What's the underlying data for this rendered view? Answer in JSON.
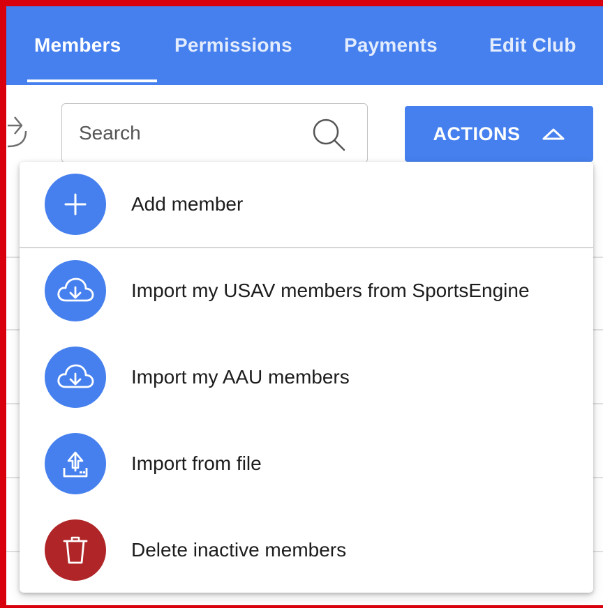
{
  "nav": {
    "tabs": [
      {
        "label": "Members",
        "active": true
      },
      {
        "label": "Permissions",
        "active": false
      },
      {
        "label": "Payments",
        "active": false
      },
      {
        "label": "Edit Club",
        "active": false
      }
    ]
  },
  "search": {
    "placeholder": "Search"
  },
  "actions": {
    "label": "ACTIONS"
  },
  "menu": {
    "items": [
      {
        "label": "Add member",
        "icon": "plus-icon"
      },
      {
        "label": "Import my USAV members from SportsEngine",
        "icon": "cloud-download-icon"
      },
      {
        "label": "Import my AAU members",
        "icon": "cloud-download-icon"
      },
      {
        "label": "Import from file",
        "icon": "upload-file-icon"
      },
      {
        "label": "Delete inactive members",
        "icon": "trash-icon"
      }
    ]
  },
  "colors": {
    "primary": "#4680ee",
    "danger": "#b02628",
    "frame": "#d9000d"
  }
}
